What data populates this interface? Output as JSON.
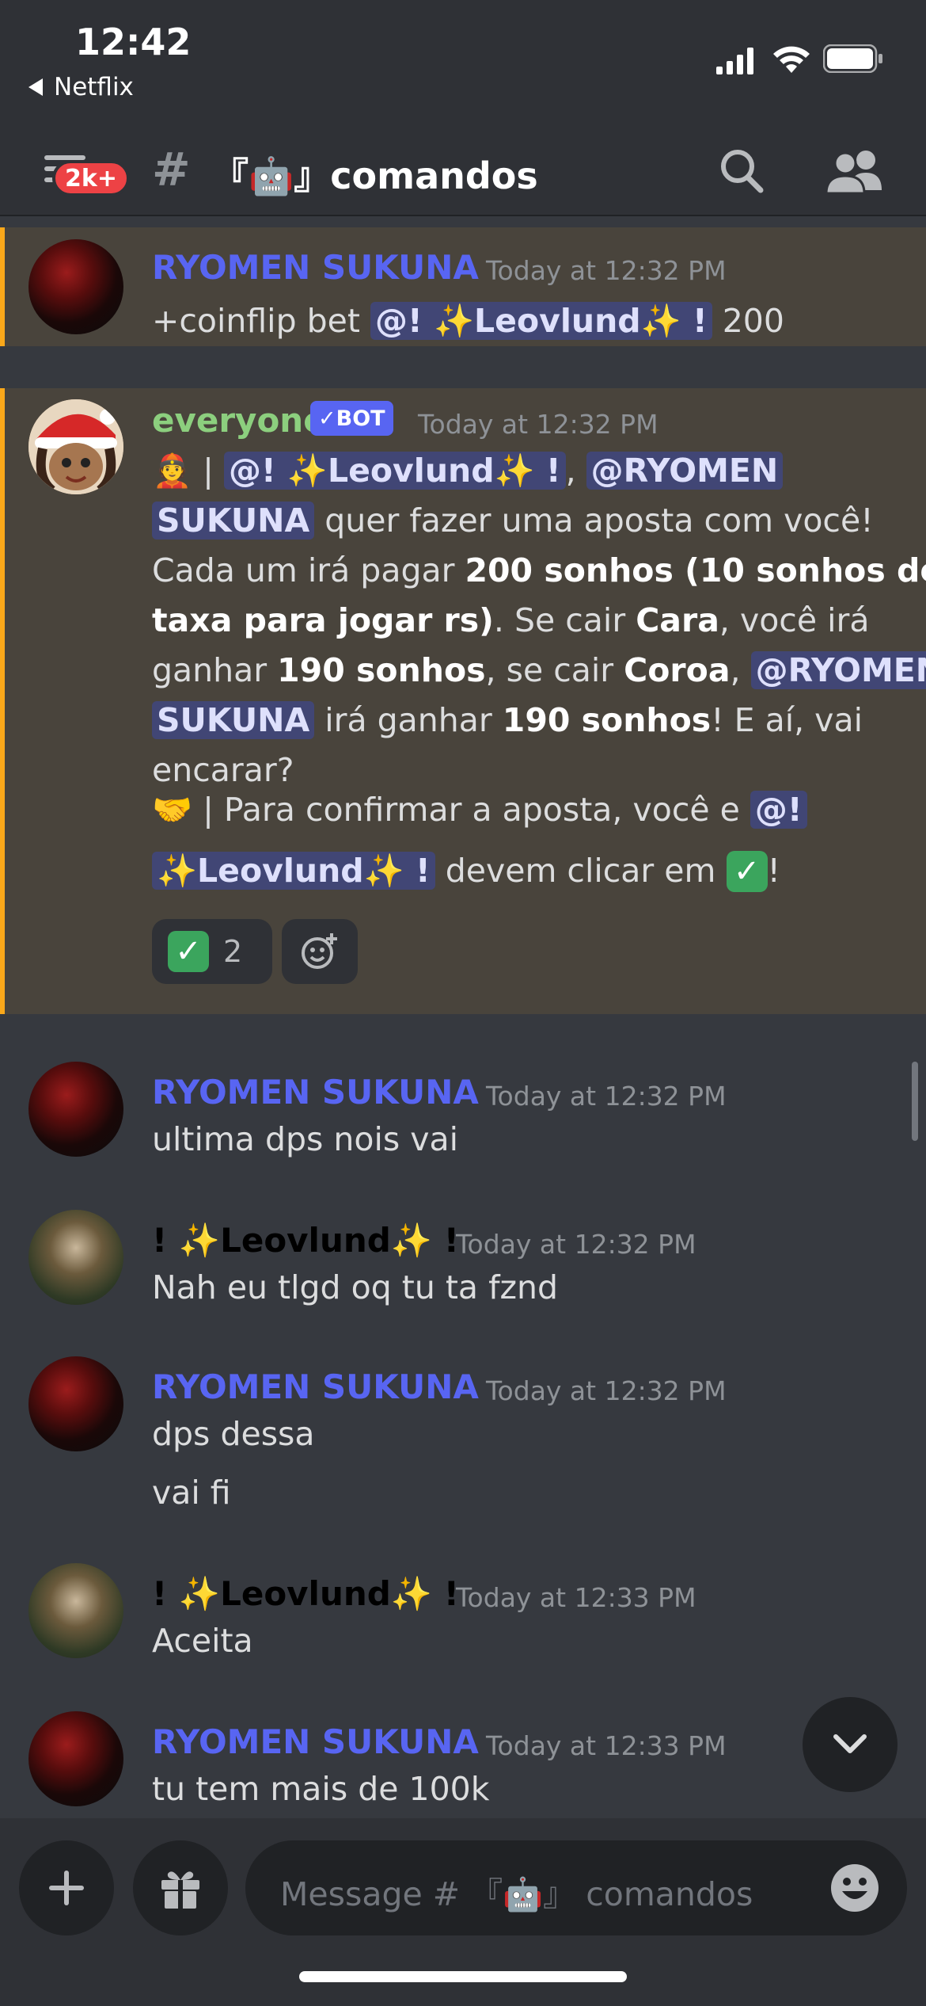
{
  "status_bar": {
    "time": "12:42",
    "back_app": "Netflix"
  },
  "header": {
    "badge": "2k+",
    "hash": "#",
    "channel_name": "『🤖』comandos",
    "icons": [
      "menu-icon",
      "search-icon",
      "members-icon"
    ]
  },
  "messages": [
    {
      "author": "RYOMEN SUKUNA",
      "timestamp": "Today at 12:32 PM",
      "text_prefix": "+coinflip bet ",
      "mention": "@! ✨Leovlund✨ !",
      "text_suffix": " 200"
    },
    {
      "author": "everyone",
      "bot_tag": "✓BOT",
      "timestamp": "Today at 12:32 PM",
      "line1_prefix": "👲 | ",
      "line1_mention1": "@! ✨Leovlund✨ !",
      "line1_comma": ", ",
      "line1_mention2": "@RYOMEN",
      "line2_mention": "SUKUNA",
      "line2_text": " quer fazer uma aposta com você!",
      "line3_text": "Cada um irá pagar ",
      "line3_bold": "200 sonhos (10 sonhos de",
      "line4_bold": "taxa para jogar rs)",
      "line4_text": ". Se cair ",
      "line4_bold2": "Cara",
      "line4_text2": ", você irá",
      "line5_text": "ganhar ",
      "line5_bold": "190 sonhos",
      "line5_text2": ", se cair ",
      "line5_bold2": "Coroa",
      "line5_text3": ", ",
      "line5_mention": "@RYOMEN",
      "line6_mention": "SUKUNA",
      "line6_text": " irá ganhar ",
      "line6_bold": "190 sonhos",
      "line6_text2": "! E aí, vai",
      "line7_text": "encarar?",
      "line8_prefix": "🤝 | Para confirmar a aposta, você e ",
      "line8_mention": "@!",
      "line9_mention": "✨Leovlund✨ !",
      "line9_text": " devem clicar em ",
      "line9_end": "!",
      "reaction_count": "2"
    },
    {
      "author": "RYOMEN SUKUNA",
      "timestamp": "Today at 12:32 PM",
      "lines": [
        "ultima dps nois vai"
      ]
    },
    {
      "author": "! ✨Leovlund✨ !",
      "timestamp": "Today at 12:32 PM",
      "lines": [
        "Nah eu tlgd oq tu ta fznd"
      ]
    },
    {
      "author": "RYOMEN SUKUNA",
      "timestamp": "Today at 12:32 PM",
      "lines": [
        "dps dessa",
        "vai fi"
      ]
    },
    {
      "author": "! ✨Leovlund✨ !",
      "timestamp": "Today at 12:33 PM",
      "lines": [
        "Aceita"
      ]
    },
    {
      "author": "RYOMEN SUKUNA",
      "timestamp": "Today at 12:33 PM",
      "lines": [
        "tu tem mais de 100k"
      ]
    }
  ],
  "composer": {
    "placeholder": "Message # 『🤖』 comandos"
  },
  "colors": {
    "background": "#36393f",
    "header": "#2f3136",
    "mention_bg": "#414675",
    "highlight_bg": "#49443c",
    "highlight_border": "#faa81a",
    "blurple": "#5865f2"
  }
}
